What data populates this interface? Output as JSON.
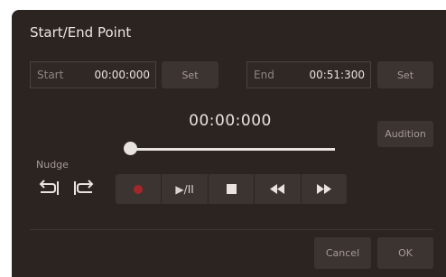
{
  "dialog": {
    "title": "Start/End Point"
  },
  "start": {
    "label": "Start",
    "value": "00:00:000",
    "set_label": "Set"
  },
  "end": {
    "label": "End",
    "value": "00:51:300",
    "set_label": "Set"
  },
  "position": {
    "time": "00:00:000",
    "slider_fraction": 0
  },
  "audition_label": "Audition",
  "nudge": {
    "label": "Nudge",
    "buttons": [
      "nudge-left-icon",
      "nudge-right-icon"
    ]
  },
  "transport": {
    "icons": [
      "record-icon",
      "play-pause-icon",
      "stop-icon",
      "rewind-icon",
      "fast-forward-icon"
    ],
    "play_pause_glyph": "▶/II",
    "record_color": "#a3262b"
  },
  "footer": {
    "cancel_label": "Cancel",
    "ok_label": "OK"
  },
  "colors": {
    "background": "#2b2421",
    "text": "#e9e3df",
    "button": "#3c3431"
  }
}
